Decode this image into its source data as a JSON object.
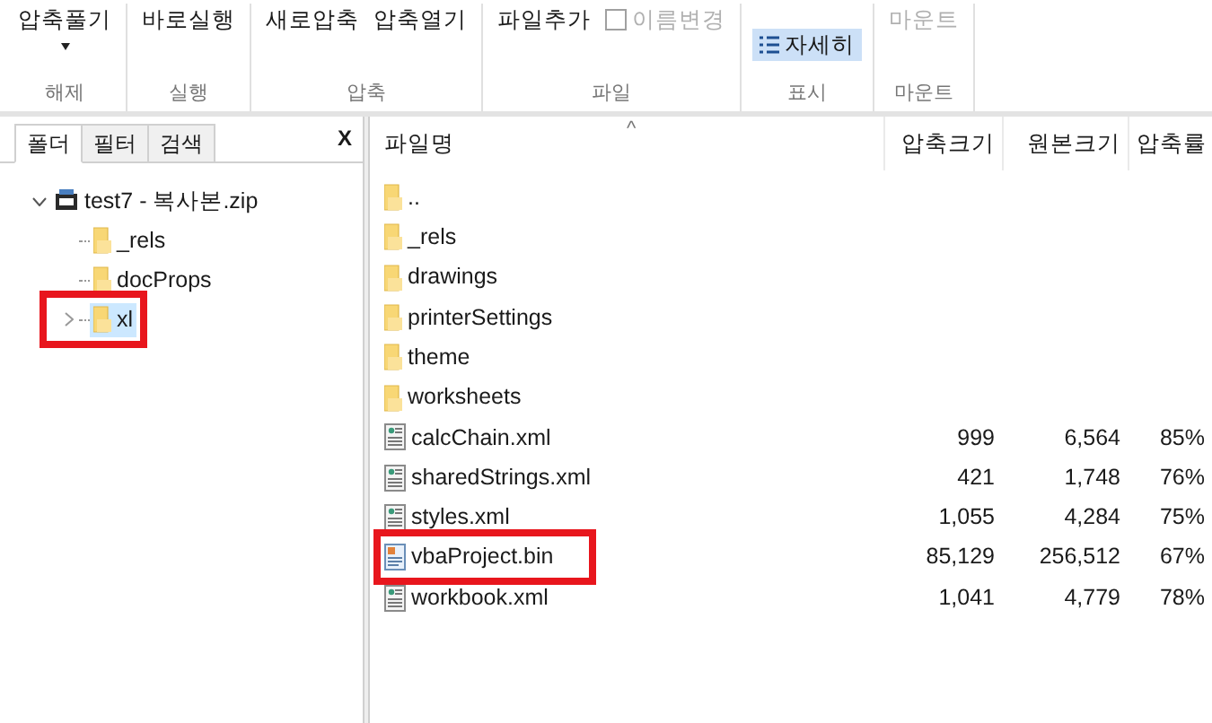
{
  "ribbon": {
    "groups": [
      {
        "label": "해제",
        "buttons": [
          {
            "label": "압축풀기",
            "dropdown": true,
            "disabled": false,
            "selected": false
          }
        ]
      },
      {
        "label": "실행",
        "buttons": [
          {
            "label": "바로실행",
            "dropdown": false,
            "disabled": false,
            "selected": false
          }
        ]
      },
      {
        "label": "압축",
        "buttons": [
          {
            "label": "새로압축",
            "dropdown": false,
            "disabled": false,
            "selected": false
          },
          {
            "label": "압축열기",
            "dropdown": false,
            "disabled": false,
            "selected": false
          }
        ]
      },
      {
        "label": "파일",
        "buttons": [
          {
            "label": "파일추가",
            "dropdown": false,
            "disabled": false,
            "selected": false
          },
          {
            "label": "이름변경",
            "kind": "checkbox",
            "dropdown": false,
            "disabled": true,
            "selected": false
          }
        ]
      },
      {
        "label": "표시",
        "buttons": [
          {
            "label": "자세히",
            "kind": "list",
            "dropdown": false,
            "disabled": false,
            "selected": true
          }
        ]
      },
      {
        "label": "마운트",
        "buttons": [
          {
            "label": "마운트",
            "dropdown": false,
            "disabled": true,
            "selected": false
          }
        ]
      }
    ]
  },
  "sidebar": {
    "tabs": [
      {
        "label": "폴더",
        "selected": true
      },
      {
        "label": "필터",
        "selected": false
      },
      {
        "label": "검색",
        "selected": false
      }
    ],
    "close": "X",
    "tree": [
      {
        "label": "test7 - 복사본.zip",
        "kind": "zip",
        "expanded": true,
        "selected": false,
        "children": [
          {
            "label": "_rels",
            "kind": "folder",
            "selected": false
          },
          {
            "label": "docProps",
            "kind": "folder",
            "selected": false
          },
          {
            "label": "xl",
            "kind": "folder",
            "expanded": false,
            "selected": true,
            "highlighted": true
          }
        ]
      }
    ]
  },
  "file_list": {
    "columns": [
      "파일명",
      "압축크기",
      "원본크기",
      "압축률"
    ],
    "sort_indicator": "^",
    "rows": [
      {
        "kind": "folder",
        "name": ".."
      },
      {
        "kind": "folder",
        "name": "_rels"
      },
      {
        "kind": "folder",
        "name": "drawings"
      },
      {
        "kind": "folder",
        "name": "printerSettings"
      },
      {
        "kind": "folder",
        "name": "theme"
      },
      {
        "kind": "folder",
        "name": "worksheets"
      },
      {
        "kind": "document",
        "name": "calcChain.xml",
        "packed": "999",
        "original": "6,564",
        "ratio": "85%"
      },
      {
        "kind": "document",
        "name": "sharedStrings.xml",
        "packed": "421",
        "original": "1,748",
        "ratio": "76%"
      },
      {
        "kind": "document",
        "name": "styles.xml",
        "packed": "1,055",
        "original": "4,284",
        "ratio": "75%"
      },
      {
        "kind": "binary",
        "name": "vbaProject.bin",
        "packed": "85,129",
        "original": "256,512",
        "ratio": "67%",
        "highlighted": true
      },
      {
        "kind": "document",
        "name": "workbook.xml",
        "packed": "1,041",
        "original": "4,779",
        "ratio": "78%"
      }
    ]
  }
}
